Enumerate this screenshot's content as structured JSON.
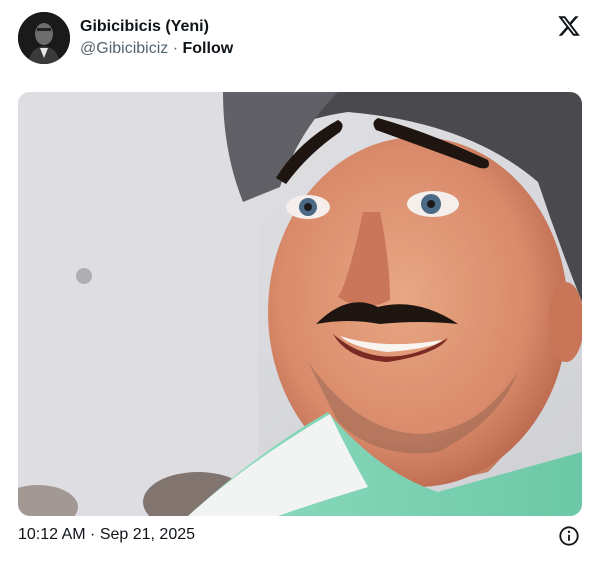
{
  "author": {
    "display_name": "Gibicibicis (Yeni)",
    "handle": "@Gibicibiciz",
    "separator": "·",
    "follow_label": "Follow",
    "avatar_icon": "profile-avatar"
  },
  "header": {
    "logo_icon": "x-logo-icon"
  },
  "media": {
    "type": "photo",
    "subject": "smiling man with drawn-on eyebrows and mustache"
  },
  "footer": {
    "timestamp": "10:12 AM · Sep 21, 2025",
    "info_icon": "info-icon"
  },
  "colors": {
    "text_primary": "#0f1419",
    "text_secondary": "#536471",
    "background": "#ffffff",
    "shirt_accent": "#7fd4b5"
  }
}
